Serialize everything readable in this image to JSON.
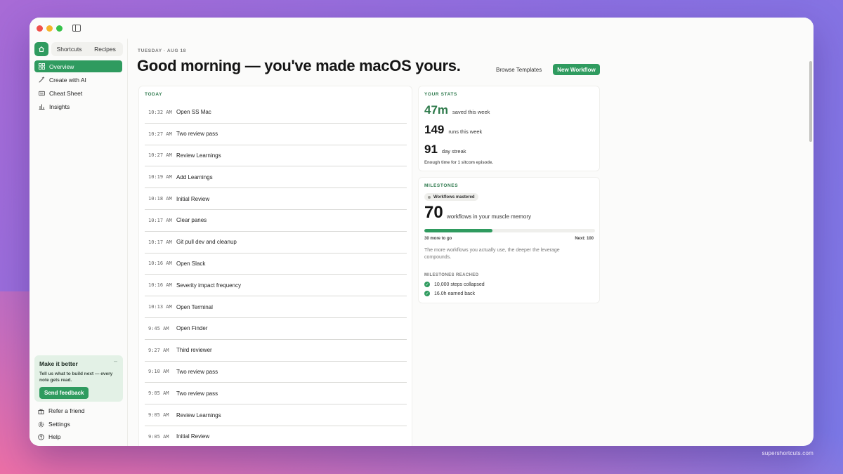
{
  "sidebar": {
    "tabs": [
      "Shortcuts",
      "Recipes"
    ],
    "items": [
      {
        "label": "Overview",
        "icon": "grid-icon",
        "active": true
      },
      {
        "label": "Create with AI",
        "icon": "magic-wand-icon"
      },
      {
        "label": "Cheat Sheet",
        "icon": "keyboard-icon"
      },
      {
        "label": "Insights",
        "icon": "bar-chart-icon"
      }
    ],
    "feedback": {
      "title": "Make it better",
      "text": "Tell us what to build next — every note gets read.",
      "button": "Send feedback"
    },
    "bottom": [
      {
        "label": "Refer a friend",
        "icon": "gift-icon"
      },
      {
        "label": "Settings",
        "icon": "gear-icon"
      },
      {
        "label": "Help",
        "icon": "help-icon"
      }
    ]
  },
  "header": {
    "date": "TUESDAY · AUG 18",
    "greeting": "Good morning — you've made macOS yours.",
    "browse": "Browse Templates",
    "new_workflow": "New Workflow"
  },
  "today": {
    "label": "TODAY",
    "rows": [
      {
        "time": "10:32 AM",
        "name": "Open SS Mac"
      },
      {
        "time": "10:27 AM",
        "name": "Two review pass"
      },
      {
        "time": "10:27 AM",
        "name": "Review Learnings"
      },
      {
        "time": "10:19 AM",
        "name": "Add Learnings"
      },
      {
        "time": "10:18 AM",
        "name": "Initial Review"
      },
      {
        "time": "10:17 AM",
        "name": "Clear panes"
      },
      {
        "time": "10:17 AM",
        "name": "Git pull dev and cleanup"
      },
      {
        "time": "10:16 AM",
        "name": "Open Slack"
      },
      {
        "time": "10:16 AM",
        "name": "Severity impact frequency"
      },
      {
        "time": "10:13 AM",
        "name": "Open Terminal"
      },
      {
        "time": "9:45 AM",
        "name": "Open Finder"
      },
      {
        "time": "9:27 AM",
        "name": "Third reviewer"
      },
      {
        "time": "9:10 AM",
        "name": "Two review pass"
      },
      {
        "time": "9:05 AM",
        "name": "Two review pass"
      },
      {
        "time": "9:05 AM",
        "name": "Review Learnings"
      },
      {
        "time": "9:05 AM",
        "name": "Initial Review"
      }
    ]
  },
  "stats": {
    "label": "YOUR STATS",
    "saved_num": "47m",
    "saved_label": "saved this week",
    "runs_num": "149",
    "runs_label": "runs this week",
    "streak_num": "91",
    "streak_label": "day streak",
    "note": "Enough time for 1 sitcom episode."
  },
  "milestones": {
    "label": "MILESTONES",
    "badge": "Workflows mastered",
    "count": "70",
    "count_label": "workflows in your muscle memory",
    "progress_percent": 40,
    "left_text": "30 more to go",
    "right_text": "Next: 100",
    "description": "The more workflows you actually use, the deeper the leverage compounds.",
    "reached_label": "MILESTONES REACHED",
    "reached": [
      "10,000 steps collapsed",
      "16.0h earned back"
    ]
  },
  "footer_brand": "supershortcuts.com",
  "colors": {
    "accent": "#2f9b5f",
    "accent_text": "#2e7a4b"
  }
}
